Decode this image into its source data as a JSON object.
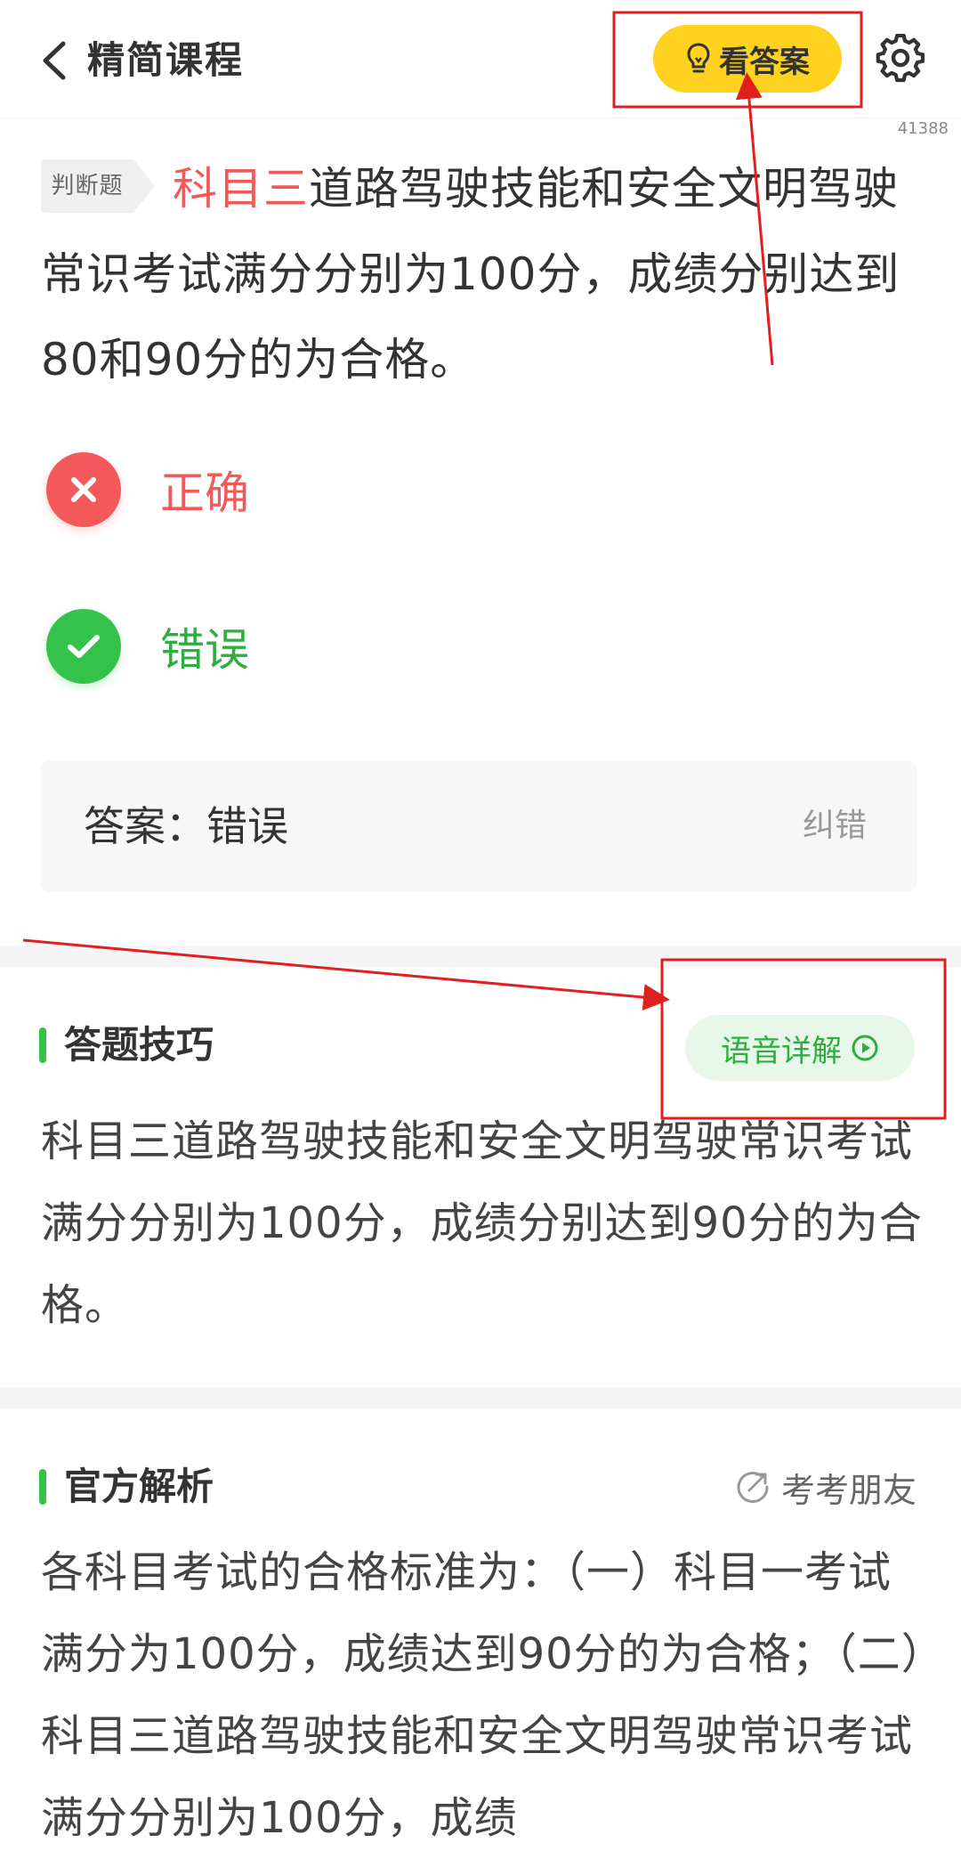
{
  "header": {
    "title": "精简课程",
    "answer_button": "看答案",
    "question_id": "41388"
  },
  "question": {
    "type_badge": "判断题",
    "highlight": "科目三",
    "text": "道路驾驶技能和安全文明驾驶常识考试满分分别为100分，成绩分别达到80和90分的为合格。"
  },
  "options": [
    {
      "label": "正确",
      "status": "wrong"
    },
    {
      "label": "错误",
      "status": "correct"
    }
  ],
  "answer_box": {
    "text": "答案：错误",
    "correction": "纠错"
  },
  "tips": {
    "title": "答题技巧",
    "voice_button": "语音详解",
    "body": "科目三道路驾驶技能和安全文明驾驶常识考试满分分别为100分，成绩分别达到90分的为合格。"
  },
  "official": {
    "title": "官方解析",
    "share_link": "考考朋友",
    "body": "各科目考试的合格标准为：（一）科目一考试满分为100分，成绩达到90分的为合格；（二）科目三道路驾驶技能和安全文明驾驶常识考试满分分别为100分，成绩"
  },
  "colors": {
    "accent_yellow": "#ffd21f",
    "correct_green": "#34c24a",
    "wrong_red": "#f3585b",
    "annotation_red": "#e02020"
  },
  "icons": {
    "back": "chevron-left-icon",
    "bulb": "lightbulb-icon",
    "settings": "gear-icon",
    "wrong": "close-icon",
    "correct": "check-icon",
    "play": "play-circle-icon",
    "share": "share-icon"
  }
}
